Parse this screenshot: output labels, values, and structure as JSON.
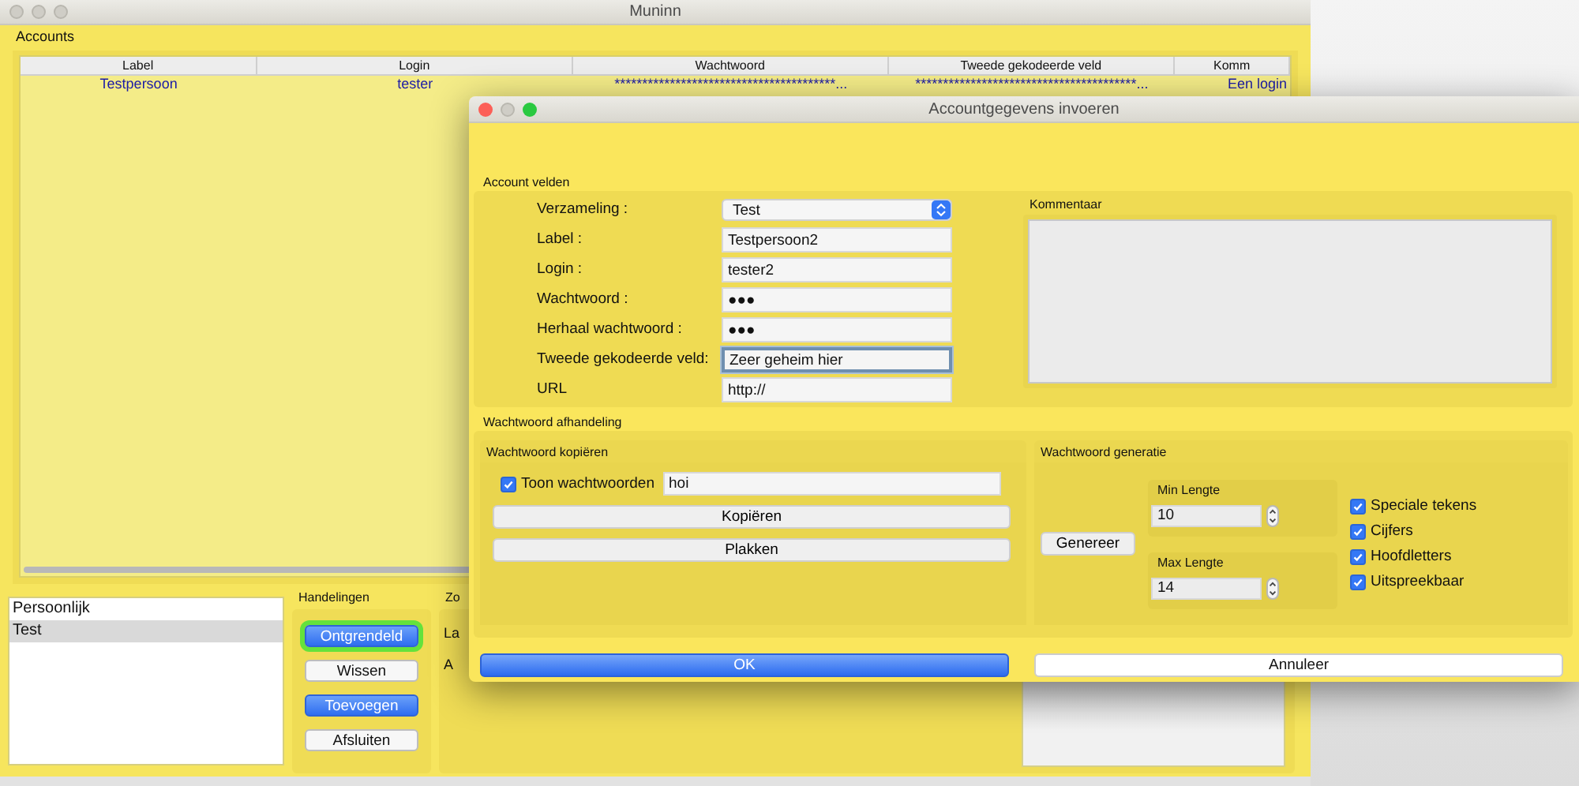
{
  "main_window": {
    "title": "Muninn",
    "section_label": "Accounts",
    "table": {
      "columns": [
        "Label",
        "Login",
        "Wachtwoord",
        "Tweede gekodeerde veld",
        "Komm"
      ],
      "rows": [
        {
          "cells": [
            "Testpersoon",
            "tester",
            "****************************************...",
            "****************************************...",
            "Een login"
          ]
        }
      ]
    },
    "collections": [
      {
        "label": "Persoonlijk",
        "selected": false
      },
      {
        "label": "Test",
        "selected": true
      }
    ],
    "actions": {
      "title": "Handelingen",
      "buttons": [
        {
          "label": "Ontgrendeld",
          "kind": "primary",
          "focused": true
        },
        {
          "label": "Wissen",
          "kind": "secondary",
          "focused": false
        },
        {
          "label": "Toevoegen",
          "kind": "primary",
          "focused": false
        },
        {
          "label": "Afsluiten",
          "kind": "secondary",
          "focused": false
        }
      ]
    },
    "search": {
      "title": "Zo",
      "labels": [
        "La",
        "A"
      ]
    }
  },
  "dialog": {
    "title": "Accountgegevens invoeren",
    "account_fields": {
      "title": "Account velden",
      "comment_label": "Kommentaar",
      "fields": [
        {
          "label": "Verzameling :",
          "kind": "select",
          "value": "Test",
          "focused": false
        },
        {
          "label": "Label :",
          "kind": "text",
          "value": "Testpersoon2",
          "focused": false
        },
        {
          "label": "Login :",
          "kind": "text",
          "value": "tester2",
          "focused": false
        },
        {
          "label": "Wachtwoord :",
          "kind": "text",
          "value": "●●●",
          "focused": false
        },
        {
          "label": "Herhaal wachtwoord :",
          "kind": "text",
          "value": "●●●",
          "focused": false
        },
        {
          "label": "Tweede gekodeerde veld:",
          "kind": "text",
          "value": "Zeer geheim hier",
          "focused": true
        },
        {
          "label": "URL",
          "kind": "text",
          "value": "http://",
          "focused": false
        }
      ]
    },
    "password_handling": {
      "title": "Wachtwoord afhandeling",
      "copy": {
        "title": "Wachtwoord kopiëren",
        "show_passwords": {
          "label": "Toon wachtwoorden",
          "checked": true
        },
        "value": "hoi",
        "buttons": [
          "Kopiëren",
          "Plakken"
        ]
      },
      "generation": {
        "title": "Wachtwoord generatie",
        "button": "Genereer",
        "min": {
          "label": "Min Lengte",
          "value": "10"
        },
        "max": {
          "label": "Max Lengte",
          "value": "14"
        },
        "options": [
          {
            "label": "Speciale tekens",
            "checked": true
          },
          {
            "label": "Cijfers",
            "checked": true
          },
          {
            "label": "Hoofdletters",
            "checked": true
          },
          {
            "label": "Uitspreekbaar",
            "checked": true
          }
        ]
      }
    },
    "buttons": [
      {
        "label": "OK",
        "kind": "primary"
      },
      {
        "label": "Annuleer",
        "kind": "secondary"
      }
    ]
  }
}
